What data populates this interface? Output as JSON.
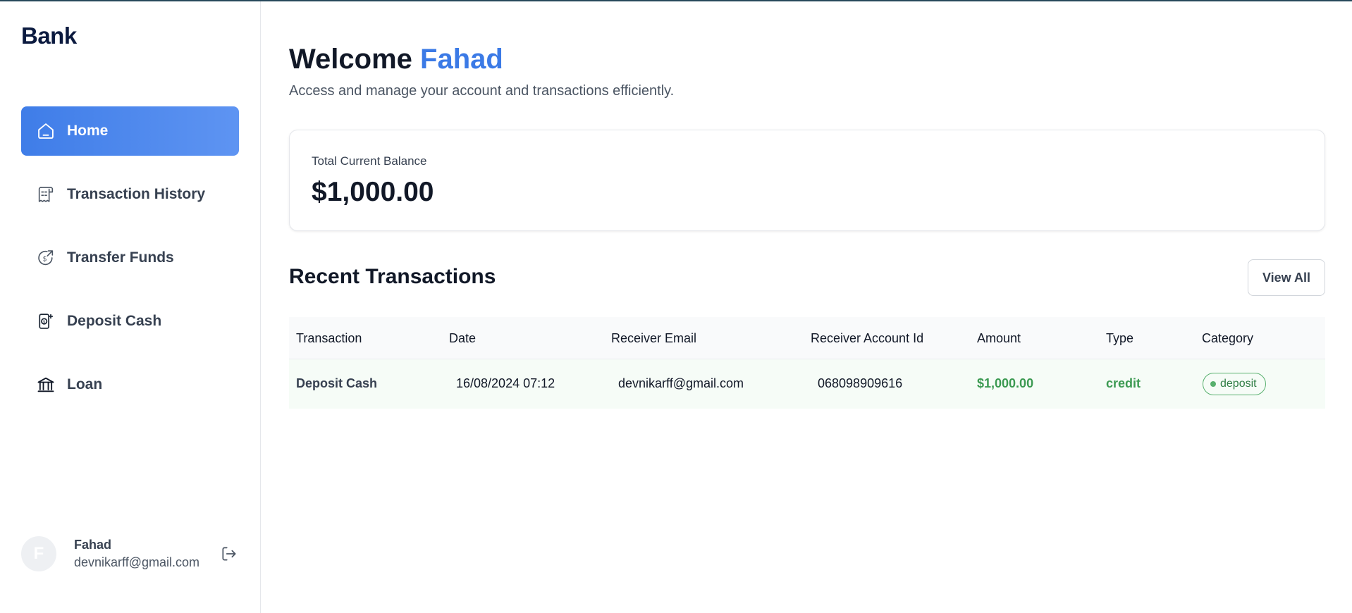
{
  "app": {
    "logo": "Bank"
  },
  "sidebar": {
    "items": [
      {
        "label": "Home",
        "icon": "home-icon",
        "active": true
      },
      {
        "label": "Transaction History",
        "icon": "receipt-icon",
        "active": false
      },
      {
        "label": "Transfer Funds",
        "icon": "dollar-transfer-icon",
        "active": false
      },
      {
        "label": "Deposit Cash",
        "icon": "deposit-phone-icon",
        "active": false
      },
      {
        "label": "Loan",
        "icon": "bank-building-icon",
        "active": false
      }
    ],
    "user": {
      "avatar_initial": "F",
      "name": "Fahad",
      "email": "devnikarff@gmail.com"
    }
  },
  "header": {
    "welcome_prefix": "Welcome",
    "user_name": "Fahad",
    "subtitle": "Access and manage your account and transactions efficiently."
  },
  "balance": {
    "label": "Total Current Balance",
    "value": "$1,000.00"
  },
  "transactions": {
    "title": "Recent Transactions",
    "view_all_label": "View All",
    "columns": [
      "Transaction",
      "Date",
      "Receiver Email",
      "Receiver Account Id",
      "Amount",
      "Type",
      "Category"
    ],
    "rows": [
      {
        "transaction": "Deposit Cash",
        "date": "16/08/2024 07:12",
        "receiver_email": "devnikarff@gmail.com",
        "receiver_account_id": "068098909616",
        "amount": "$1,000.00",
        "type": "credit",
        "category": "deposit"
      }
    ]
  },
  "colors": {
    "accent": "#3b7ae6",
    "credit_green": "#3c9a52",
    "row_highlight": "#f6fcf7"
  }
}
